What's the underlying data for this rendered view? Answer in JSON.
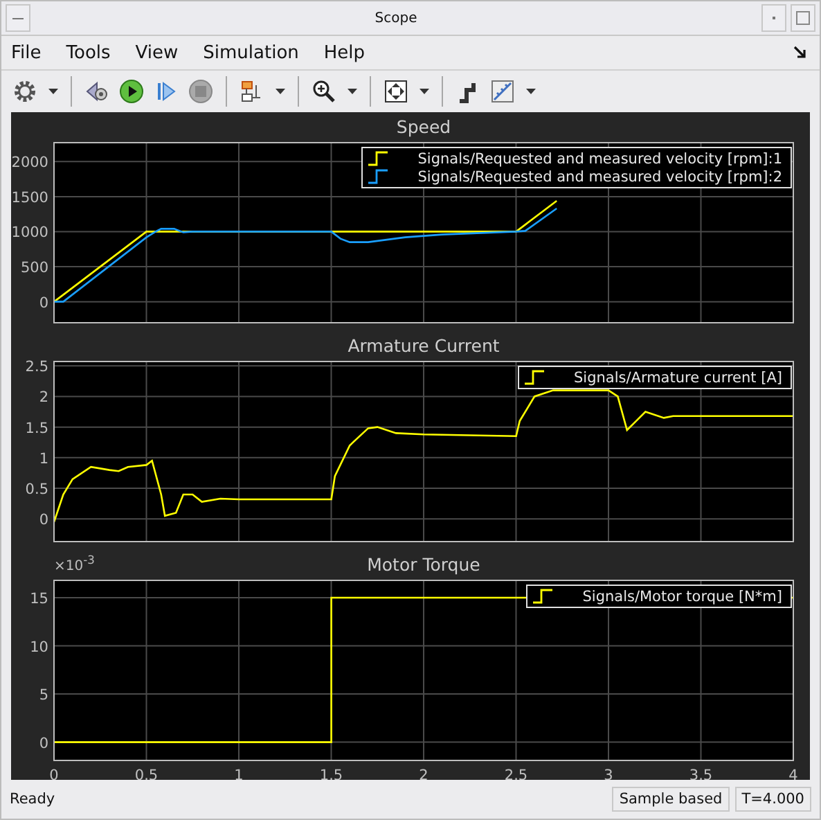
{
  "window": {
    "title": "Scope"
  },
  "menu": [
    "File",
    "Tools",
    "View",
    "Simulation",
    "Help"
  ],
  "plots": [
    {
      "chart_data": {
        "type": "line",
        "title": "Speed",
        "x": [
          0,
          0.05,
          0.5,
          0.55,
          0.58,
          0.65,
          0.7,
          0.75,
          1.5,
          1.55,
          1.6,
          1.7,
          1.9,
          2.1,
          2.5,
          2.55,
          2.72
        ],
        "series": [
          {
            "name": "Signals/Requested and measured velocity [rpm]:1",
            "color": "#ffff00",
            "values": [
              0,
              100,
              1000,
              1000,
              1000,
              1000,
              1000,
              1000,
              1000,
              1000,
              1000,
              1000,
              1000,
              1000,
              1000,
              1100,
              1440
            ]
          },
          {
            "name": "Signals/Requested and measured velocity [rpm]:2",
            "color": "#1a9fff",
            "values": [
              0,
              0,
              920,
              1000,
              1040,
              1040,
              990,
              1000,
              1000,
              900,
              850,
              850,
              920,
              960,
              1000,
              1010,
              1330
            ]
          }
        ],
        "xlim": [
          0,
          4
        ],
        "ylim": [
          -300,
          2270
        ],
        "yticks": [
          0,
          500,
          1000,
          1500,
          2000
        ],
        "grid": true,
        "legend": true
      }
    },
    {
      "chart_data": {
        "type": "line",
        "title": "Armature Current",
        "x": [
          0,
          0.05,
          0.1,
          0.2,
          0.3,
          0.35,
          0.4,
          0.5,
          0.53,
          0.58,
          0.6,
          0.66,
          0.7,
          0.75,
          0.8,
          0.9,
          1,
          1.5,
          1.52,
          1.6,
          1.7,
          1.75,
          1.85,
          2,
          2.5,
          2.52,
          2.6,
          2.7,
          3,
          3.05,
          3.1,
          3.15,
          3.2,
          3.3,
          3.35,
          4
        ],
        "series": [
          {
            "name": "Signals/Armature current [A]",
            "color": "#ffff00",
            "values": [
              -0.05,
              0.4,
              0.65,
              0.85,
              0.8,
              0.78,
              0.85,
              0.88,
              0.95,
              0.4,
              0.05,
              0.1,
              0.4,
              0.4,
              0.28,
              0.33,
              0.32,
              0.32,
              0.7,
              1.2,
              1.48,
              1.5,
              1.4,
              1.38,
              1.35,
              1.6,
              2.0,
              2.1,
              2.1,
              2.0,
              1.45,
              1.6,
              1.75,
              1.65,
              1.68,
              1.68
            ]
          }
        ],
        "xlim": [
          0,
          4
        ],
        "ylim": [
          -0.37,
          2.57
        ],
        "yticks": [
          0,
          0.5,
          1,
          1.5,
          2,
          2.5
        ],
        "grid": true,
        "legend": true
      }
    },
    {
      "axis_exponent": "×10$^{-3}$",
      "chart_data": {
        "type": "line",
        "title": "Motor Torque",
        "x": [
          0,
          1.5,
          1.5,
          4
        ],
        "series": [
          {
            "name": "Signals/Motor torque [N*m]",
            "color": "#ffff00",
            "values": [
              0,
              0,
              15,
              15
            ]
          }
        ],
        "xlim": [
          0,
          4
        ],
        "ylim": [
          -1.9,
          16.8
        ],
        "xticks": [
          0,
          0.5,
          1,
          1.5,
          2,
          2.5,
          3,
          3.5,
          4
        ],
        "yticks": [
          0,
          5,
          10,
          15
        ],
        "grid": true,
        "legend": true
      }
    }
  ],
  "status_bar": {
    "message": "Ready",
    "mode": "Sample based",
    "time": "T=4.000"
  }
}
